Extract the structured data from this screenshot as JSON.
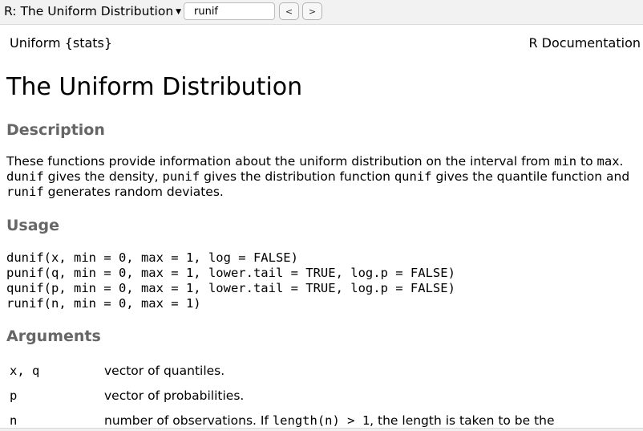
{
  "toolbar": {
    "topic_title": "R: The Uniform Distribution",
    "search_value": "runif",
    "prev_label": "<",
    "next_label": ">"
  },
  "doc": {
    "package_header": "Uniform {stats}",
    "doc_label": "R Documentation",
    "title": "The Uniform Distribution",
    "description_heading": "Description",
    "description": {
      "p1": "These functions provide information about the uniform distribution on the interval from ",
      "c1": "min",
      "p2": " to ",
      "c2": "max",
      "p3": ". ",
      "c3": "dunif",
      "p4": " gives the density, ",
      "c4": "punif",
      "p5": " gives the distribution function ",
      "c5": "qunif",
      "p6": " gives the quantile function and ",
      "c6": "runif",
      "p7": " generates random deviates."
    },
    "usage_heading": "Usage",
    "usage_lines": [
      "dunif(x, min = 0, max = 1, log = FALSE)",
      "punif(q, min = 0, max = 1, lower.tail = TRUE, log.p = FALSE)",
      "qunif(p, min = 0, max = 1, lower.tail = TRUE, log.p = FALSE)",
      "runif(n, min = 0, max = 1)"
    ],
    "arguments_heading": "Arguments",
    "arguments": [
      {
        "name": "x, q",
        "desc": "vector of quantiles."
      },
      {
        "name": "p",
        "desc": "vector of probabilities."
      },
      {
        "name": "n",
        "desc_pre": "number of observations. If ",
        "desc_code": "length(n) > 1",
        "desc_post": ", the length is taken to be the"
      }
    ]
  }
}
